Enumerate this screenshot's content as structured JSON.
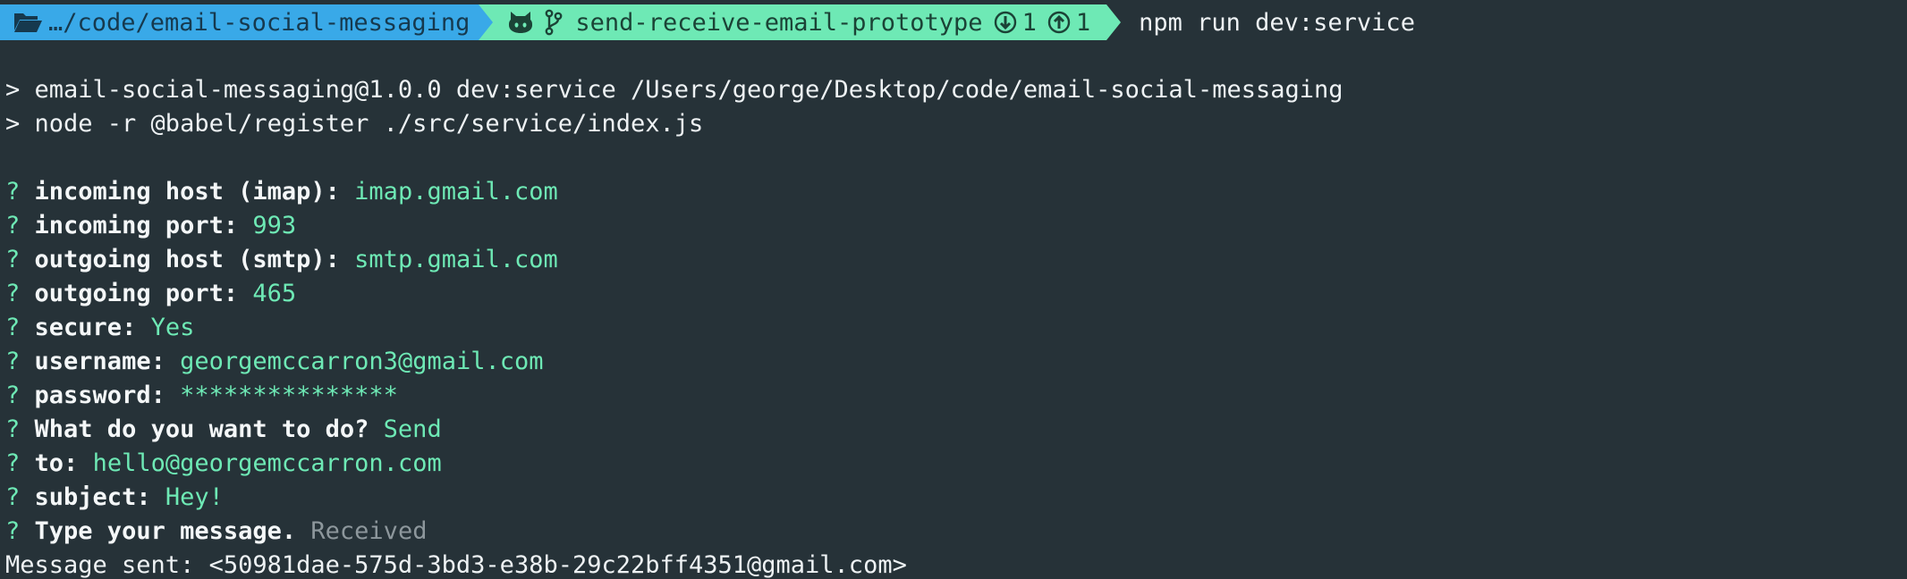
{
  "prompt": {
    "directory": "…/code/email-social-messaging",
    "branch": "send-receive-email-prototype",
    "behind_count": "1",
    "ahead_count": "1",
    "command": "npm run dev:service",
    "icons": {
      "directory": "folder-open-icon",
      "git": "github-octocat-icon",
      "branch": "git-branch-icon",
      "behind": "arrow-down-circle-icon",
      "ahead": "arrow-up-circle-icon"
    }
  },
  "script_header": [
    "> email-social-messaging@1.0.0 dev:service /Users/george/Desktop/code/email-social-messaging",
    "> node -r @babel/register ./src/service/index.js"
  ],
  "questions": [
    {
      "marker": "?",
      "label": "incoming host (imap):",
      "answer": "imap.gmail.com"
    },
    {
      "marker": "?",
      "label": "incoming port:",
      "answer": "993"
    },
    {
      "marker": "?",
      "label": "outgoing host (smtp):",
      "answer": "smtp.gmail.com"
    },
    {
      "marker": "?",
      "label": "outgoing port:",
      "answer": "465"
    },
    {
      "marker": "?",
      "label": "secure:",
      "answer": "Yes"
    },
    {
      "marker": "?",
      "label": "username:",
      "answer": "georgemccarron3@gmail.com"
    },
    {
      "marker": "?",
      "label": "password:",
      "answer": "***************"
    },
    {
      "marker": "?",
      "label": "What do you want to do?",
      "answer": "Send"
    },
    {
      "marker": "?",
      "label": "to:",
      "answer": "hello@georgemccarron.com"
    },
    {
      "marker": "?",
      "label": "subject:",
      "answer": "Hey!"
    },
    {
      "marker": "?",
      "label": "Type your message.",
      "answer": "Received"
    }
  ],
  "result": "Message sent: <50981dae-575d-3bd3-e38b-29c22bff4351@gmail.com>",
  "colors": {
    "background": "#263238",
    "directory_segment": "#39a9e8",
    "git_segment": "#6ee9b5",
    "answer": "#6ee9b5",
    "muted_answer": "#8d979c"
  }
}
